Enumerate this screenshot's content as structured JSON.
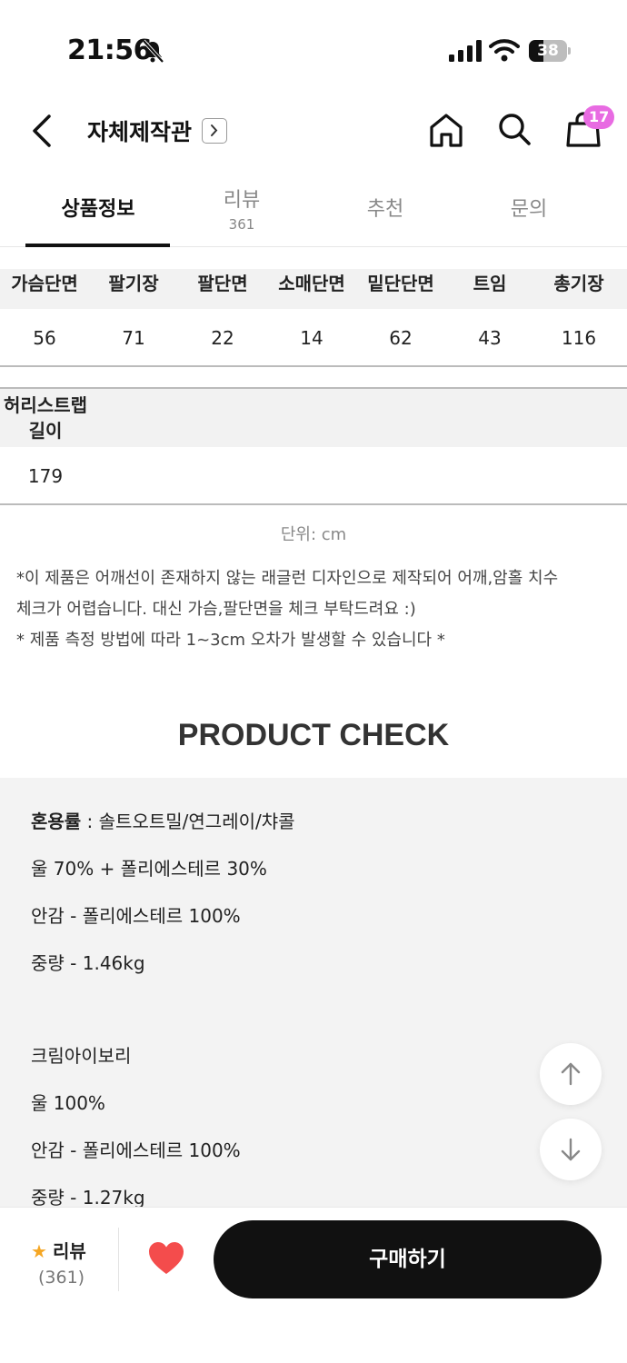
{
  "status_bar": {
    "time": "21:56",
    "battery": "38",
    "battery_level": 0.38
  },
  "header": {
    "title": "자체제작관",
    "cart_count": "17"
  },
  "tabs": [
    {
      "label": "상품정보",
      "count": ""
    },
    {
      "label": "리뷰",
      "count": "361"
    },
    {
      "label": "추천",
      "count": ""
    },
    {
      "label": "문의",
      "count": ""
    }
  ],
  "size_table": {
    "headers": [
      "가슴단면",
      "팔기장",
      "팔단면",
      "소매단면",
      "밑단단면",
      "트임",
      "총기장"
    ],
    "values": [
      "56",
      "71",
      "22",
      "14",
      "62",
      "43",
      "116"
    ]
  },
  "strap_table": {
    "header_line1": "허리스트랩",
    "header_line2": "길이",
    "value": "179"
  },
  "unit_text": "단위: cm",
  "notes": [
    "*이 제품은 어깨선이 존재하지 않는 래글런 디자인으로 제작되어 어깨,암홀 치수",
    "체크가 어렵습니다. 대신 가슴,팔단면을 체크 부탁드려요 :)",
    "* 제품 측정 방법에 따라 1~3cm 오차가 발생할 수 있습니다 *"
  ],
  "product_check": {
    "title": "PRODUCT CHECK",
    "blend_label": "혼용률",
    "blend_colors": " : 솔트오트밀/연그레이/챠콜",
    "line1": "울 70% + 폴리에스테르 30%",
    "line2": "안감 - 폴리에스테르 100%",
    "line3": "중량 - 1.46kg",
    "color2": "크림아이보리",
    "line4": "울 100%",
    "line5": "안감 - 폴리에스테르 100%",
    "line6": "중량 - 1.27kg"
  },
  "bottom_bar": {
    "review_label": "리뷰",
    "review_count": "(361)",
    "buy_label": "구매하기"
  },
  "colors": {
    "accent_badge": "#e86be2",
    "heart": "#f44c4c",
    "star": "#f5a623",
    "buy_button": "#111111"
  }
}
